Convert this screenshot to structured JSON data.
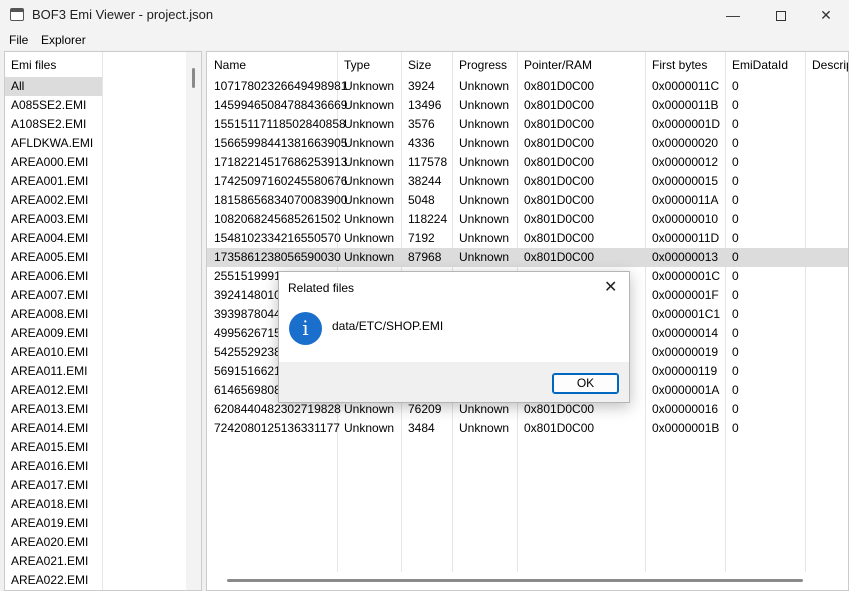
{
  "window": {
    "title": "BOF3 Emi Viewer - project.json",
    "minimize_glyph": "—",
    "close_glyph": "✕"
  },
  "menu": [
    "File",
    "Explorer"
  ],
  "left_panel": {
    "header": "Emi files",
    "items": [
      "All",
      "A085SE2.EMI",
      "A108SE2.EMI",
      "AFLDKWA.EMI",
      "AREA000.EMI",
      "AREA001.EMI",
      "AREA002.EMI",
      "AREA003.EMI",
      "AREA004.EMI",
      "AREA005.EMI",
      "AREA006.EMI",
      "AREA007.EMI",
      "AREA008.EMI",
      "AREA009.EMI",
      "AREA010.EMI",
      "AREA011.EMI",
      "AREA012.EMI",
      "AREA013.EMI",
      "AREA014.EMI",
      "AREA015.EMI",
      "AREA016.EMI",
      "AREA017.EMI",
      "AREA018.EMI",
      "AREA019.EMI",
      "AREA020.EMI",
      "AREA021.EMI",
      "AREA022.EMI"
    ],
    "selected_index": 0
  },
  "table": {
    "columns": [
      "Name",
      "Type",
      "Size",
      "Progress",
      "Pointer/RAM",
      "First bytes",
      "EmiDataId",
      "Descrip"
    ],
    "rows": [
      [
        "10717802326649498981",
        "Unknown",
        "3924",
        "Unknown",
        "0x801D0C00",
        "0x0000011C",
        "0"
      ],
      [
        "14599465084788436669",
        "Unknown",
        "13496",
        "Unknown",
        "0x801D0C00",
        "0x0000011B",
        "0"
      ],
      [
        "15515117118502840858",
        "Unknown",
        "3576",
        "Unknown",
        "0x801D0C00",
        "0x0000001D",
        "0"
      ],
      [
        "15665998441381663905",
        "Unknown",
        "4336",
        "Unknown",
        "0x801D0C00",
        "0x00000020",
        "0"
      ],
      [
        "17182214517686253913",
        "Unknown",
        "117578",
        "Unknown",
        "0x801D0C00",
        "0x00000012",
        "0"
      ],
      [
        "17425097160245580676",
        "Unknown",
        "38244",
        "Unknown",
        "0x801D0C00",
        "0x00000015",
        "0"
      ],
      [
        "18158656834070083900",
        "Unknown",
        "5048",
        "Unknown",
        "0x801D0C00",
        "0x0000011A",
        "0"
      ],
      [
        "1082068245685261502",
        "Unknown",
        "118224",
        "Unknown",
        "0x801D0C00",
        "0x00000010",
        "0"
      ],
      [
        "1548102334216550570",
        "Unknown",
        "7192",
        "Unknown",
        "0x801D0C00",
        "0x0000011D",
        "0"
      ],
      [
        "1735861238056590030",
        "Unknown",
        "87968",
        "Unknown",
        "0x801D0C00",
        "0x00000013",
        "0"
      ],
      [
        "25515199913",
        "",
        "",
        "",
        "",
        "0x0000001C",
        "0"
      ],
      [
        "39241480109",
        "",
        "",
        "",
        "",
        "0x0000001F",
        "0"
      ],
      [
        "39398780444",
        "",
        "",
        "",
        "",
        "0x000001C1",
        "0"
      ],
      [
        "49956267152",
        "",
        "",
        "",
        "",
        "0x00000014",
        "0"
      ],
      [
        "54255292389",
        "",
        "",
        "",
        "",
        "0x00000019",
        "0"
      ],
      [
        "56915166214",
        "",
        "",
        "",
        "",
        "0x00000119",
        "0"
      ],
      [
        "61465698089",
        "",
        "",
        "",
        "",
        "0x0000001A",
        "0"
      ],
      [
        "6208440482302719828",
        "Unknown",
        "76209",
        "Unknown",
        "0x801D0C00",
        "0x00000016",
        "0"
      ],
      [
        "7242080125136331177",
        "Unknown",
        "3484",
        "Unknown",
        "0x801D0C00",
        "0x0000001B",
        "0"
      ]
    ],
    "highlighted_index": 9
  },
  "dialog": {
    "title": "Related files",
    "close_glyph": "✕",
    "icon_glyph": "i",
    "message": "data/ETC/SHOP.EMI",
    "ok_label": "OK"
  }
}
